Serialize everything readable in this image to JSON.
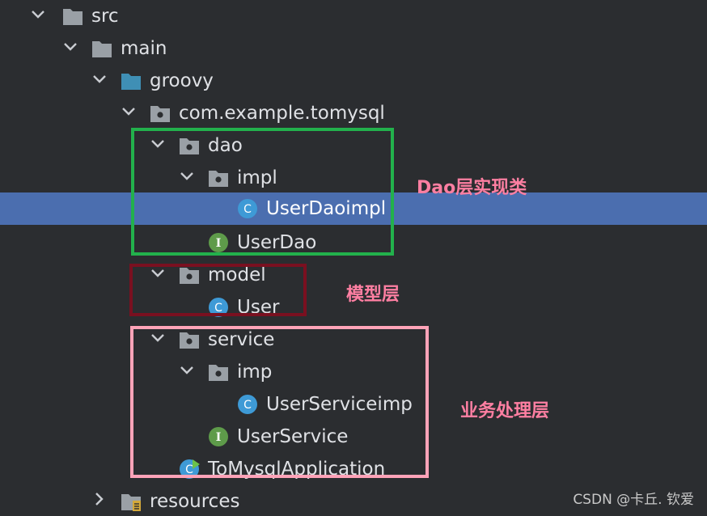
{
  "tree": {
    "nodes": [
      {
        "label": "src",
        "icon": "folder-icon",
        "expanded": true
      },
      {
        "label": "main",
        "icon": "folder-icon",
        "expanded": true
      },
      {
        "label": "groovy",
        "icon": "source-root-folder-icon",
        "expanded": true
      },
      {
        "label": "com.example.tomysql",
        "icon": "package-icon",
        "expanded": true
      },
      {
        "label": "dao",
        "icon": "package-icon",
        "expanded": true
      },
      {
        "label": "impl",
        "icon": "package-icon",
        "expanded": true
      },
      {
        "label": "UserDaoimpl",
        "icon": "class-icon",
        "icon_letter": "C",
        "selected": true
      },
      {
        "label": "UserDao",
        "icon": "interface-icon",
        "icon_letter": "I"
      },
      {
        "label": "model",
        "icon": "package-icon",
        "expanded": true
      },
      {
        "label": "User",
        "icon": "class-icon",
        "icon_letter": "C"
      },
      {
        "label": "service",
        "icon": "package-icon",
        "expanded": true
      },
      {
        "label": "imp",
        "icon": "package-icon",
        "expanded": true
      },
      {
        "label": "UserServiceimp",
        "icon": "class-icon",
        "icon_letter": "C"
      },
      {
        "label": "UserService",
        "icon": "interface-icon",
        "icon_letter": "I"
      },
      {
        "label": "ToMysqlApplication",
        "icon": "spring-boot-class-icon",
        "icon_letter": "C"
      },
      {
        "label": "resources",
        "icon": "resources-folder-icon",
        "expanded": false
      }
    ]
  },
  "annotations": {
    "dao": {
      "text": "Dao层实现类",
      "color": "#22b14c"
    },
    "model": {
      "text": "模型层",
      "color": "#7a1020"
    },
    "service": {
      "text": "业务处理层",
      "color": "#ffa3b8"
    }
  },
  "colors": {
    "background": "#2b2d30",
    "selection": "#4b6eaf",
    "annotation_text": "#ff7fa2"
  },
  "watermark": "CSDN @卡丘. 钦爱"
}
